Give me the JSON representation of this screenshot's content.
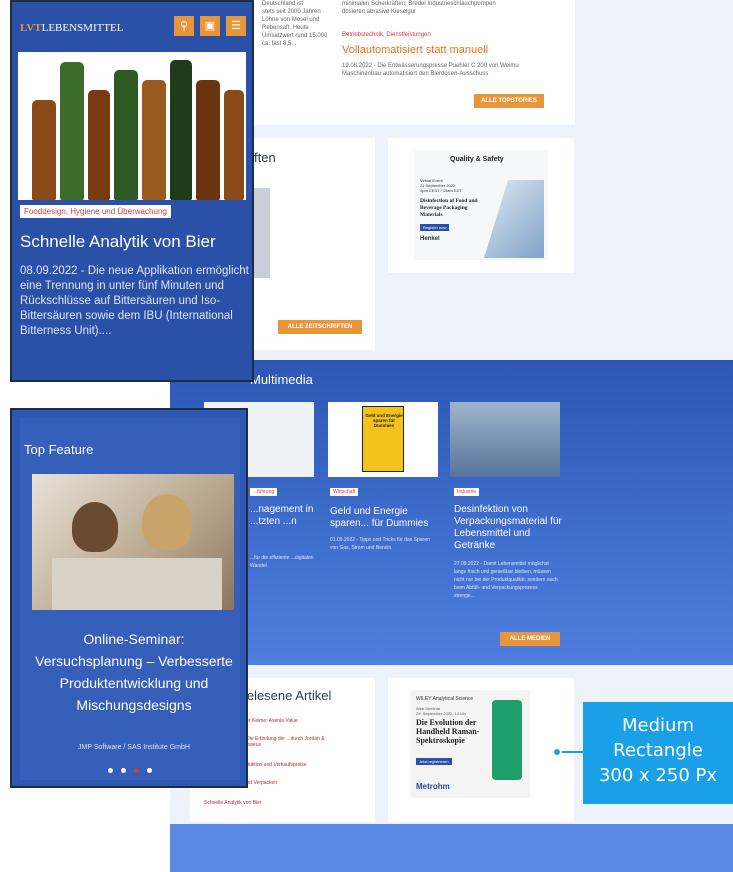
{
  "background_page": {
    "top_text": [
      "Deutschland ist",
      "stets seit 2000 Jahren",
      "Löhne von Mosel und",
      "Rebensaft. Heute",
      "Umsatzwert rund 15.000",
      "ca. fast 8,5..."
    ],
    "top_text_right": [
      "minimalen Scherkräften: Bredel Industrieschlauchpumpen",
      "dosieren abrasive Kieselgur"
    ],
    "story_tag": "Betriebstechnik, Dienstleistungen",
    "story_headline": "Vollautomatisiert statt manuell",
    "story_text": "19.08.2022 - Die Entwässerungspresse Puehler C 200 von Weimu Maschinenbau automatisiert den Bierdosen-Ausschuss",
    "topstories_button": "ALLE TOPSTORIES",
    "zeitschriften_title": "ften",
    "zeitschriften_button": "ALLE ZEITSCHRIFTEN",
    "webinar_ad": {
      "brand": "Quality & Safety",
      "event": [
        "Virtual Event",
        "21 September 2022",
        "4pm CEST / 10am EDT"
      ],
      "title": "Disinfection of Food and Beverage Packaging Materials",
      "register": "Register now",
      "sponsor": "Henkel"
    },
    "multimedia_title": "Multimedia",
    "media_items": [
      {
        "tag": "...führung",
        "headline": "...nagement in ...tzten ...n",
        "text": "...für die effiziente ...digitalen Wandel"
      },
      {
        "tag": "Wirtschaft",
        "headline": "Geld und Energie sparen... für Dummies",
        "text": "01.09.2022 - Tipps und Tricks für das Sparen von Gas, Strom und Benzin."
      },
      {
        "tag": "Industrie",
        "headline": "Desinfektion von Verpackungsmaterial für Lebensmittel und Getränke",
        "text": "27.09.2022 - Damit Lebensmittel möglichst lange frisch und genießbar bleiben, müssen nicht nur bei der Produktqualität, sondern auch beim Abfüll- und Verpackungsprozess strenge..."
      }
    ],
    "media_button": "ALLE MEDIEN",
    "book_cover_title": "Geld und Energie sparen für Dummies",
    "most_read_title": "...elesene Artikel",
    "most_read": [
      "...er Keime: Axenia Value",
      "...Die Erfindung der ...durch Jordan & Timaeus",
      "...duktion und Verkaufspreise",
      "Präzises Abfüllen und Verpacken",
      "Schnelle Analytik von Bier"
    ],
    "ad": {
      "brand_top": "WILEY Analytical Science",
      "date": [
        "Web Seminar",
        "29. September 2022, 14 Uhr"
      ],
      "headline": "Die Evolution der Handheld Raman-Spektroskopie",
      "cta": "Jetzt registrieren",
      "sponsor": "Metrohm"
    }
  },
  "callout": {
    "lines": [
      "Medium",
      "Rectangle",
      "300 x 250 Px"
    ],
    "color": "#1aa0e6"
  },
  "phone1": {
    "logo_prefix": "LVT",
    "logo_main": "LEBENSMITTEL",
    "icons": [
      "search-icon",
      "lock-icon",
      "menu-icon"
    ],
    "category": "Fooddesign, Hygiene und Überwachung",
    "headline": "Schnelle Analytik von Bier",
    "teaser": "08.09.2022 -  Die neue Applikation ermöglicht eine Trennung in unter fünf Minuten und Rückschlüsse auf Bittersäuren und Iso-Bittersäuren sowie dem IBU (International Bitterness Unit)...."
  },
  "phone2": {
    "label": "Top Feature",
    "headline": "Online-Seminar: Versuchsplanung – Verbesserte Produktentwicklung und Mischungsdesigns",
    "sub": "JMP Software / SAS Institute GmbH",
    "dots": 4,
    "active_dot": 3
  },
  "colors": {
    "brand_blue": "#2a50a8",
    "accent_orange": "#e8963a",
    "tag_red": "#d23c3c"
  }
}
